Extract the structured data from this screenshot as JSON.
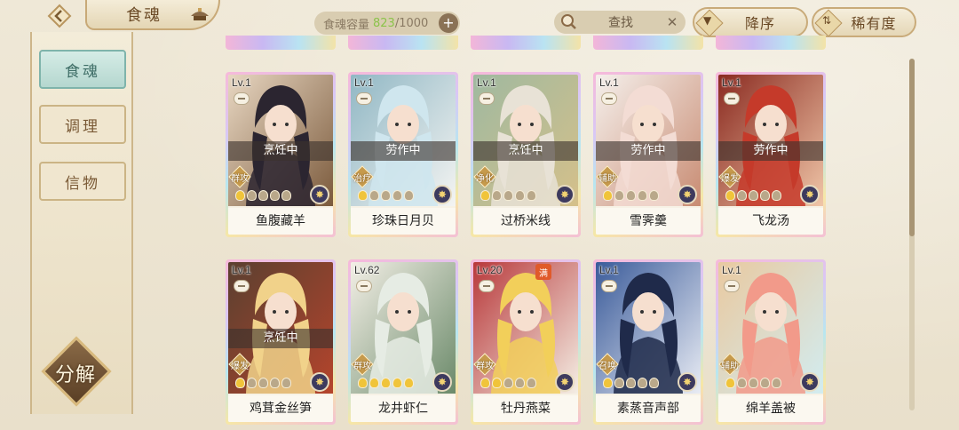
{
  "header": {
    "title": "食魂",
    "capacity_label": "食魂容量",
    "capacity_current": "823",
    "capacity_max": "/1000",
    "plus_label": "+",
    "search_label": "查找",
    "clear_label": "✕",
    "sort_order_label": "降序",
    "sort_rarity_label": "稀有度"
  },
  "sidebar": {
    "items": [
      {
        "label": "食魂",
        "active": true
      },
      {
        "label": "调理",
        "active": false
      },
      {
        "label": "信物",
        "active": false
      }
    ],
    "decompose_label": "分解"
  },
  "cards": [
    {
      "level": "Lv.1",
      "status": "烹饪中",
      "role": "群攻",
      "name": "鱼腹藏羊",
      "stars_gold": 1,
      "colors": [
        "#2b2530",
        "#7b5a3c",
        "#e8d7c2"
      ]
    },
    {
      "level": "Lv.1",
      "status": "劳作中",
      "role": "治疗",
      "name": "珍珠日月贝",
      "stars_gold": 1,
      "colors": [
        "#cfe6ee",
        "#f4f4f2",
        "#90b7c4"
      ]
    },
    {
      "level": "Lv.1",
      "status": "烹饪中",
      "role": "净化",
      "name": "过桥米线",
      "stars_gold": 1,
      "colors": [
        "#e8e2d6",
        "#d5c08a",
        "#9fb9a0"
      ]
    },
    {
      "level": "Lv.1",
      "status": "劳作中",
      "role": "辅助",
      "name": "雪霁羹",
      "stars_gold": 1,
      "colors": [
        "#f3dcd4",
        "#c88b72",
        "#f5f0ec"
      ]
    },
    {
      "level": "Lv.1",
      "status": "劳作中",
      "role": "爆发",
      "name": "飞龙汤",
      "stars_gold": 1,
      "colors": [
        "#c53a2a",
        "#f0c6a8",
        "#8a2a20"
      ]
    },
    {
      "level": "Lv.1",
      "status": "烹饪中",
      "role": "爆发",
      "name": "鸡茸金丝笋",
      "stars_gold": 1,
      "colors": [
        "#f1d28a",
        "#b5442c",
        "#5a4030"
      ]
    },
    {
      "level": "Lv.62",
      "status": "",
      "role": "群攻",
      "name": "龙井虾仁",
      "stars_gold": 5,
      "colors": [
        "#e6ece4",
        "#6b8a6a",
        "#f3efe6"
      ]
    },
    {
      "level": "Lv.20",
      "status": "",
      "role": "群攻",
      "name": "牡丹燕菜",
      "stars_gold": 2,
      "max_badge": "满",
      "colors": [
        "#f2cf5a",
        "#f4eee4",
        "#b8383a"
      ]
    },
    {
      "level": "Lv.1",
      "status": "",
      "role": "召唤",
      "name": "素蒸音声部",
      "stars_gold": 1,
      "colors": [
        "#1f2a4a",
        "#e9ecf4",
        "#3a5b9a"
      ]
    },
    {
      "level": "Lv.1",
      "status": "",
      "role": "辅助",
      "name": "绵羊盖被",
      "stars_gold": 1,
      "colors": [
        "#f29a8a",
        "#d2ecf0",
        "#e9c9a0"
      ]
    }
  ]
}
